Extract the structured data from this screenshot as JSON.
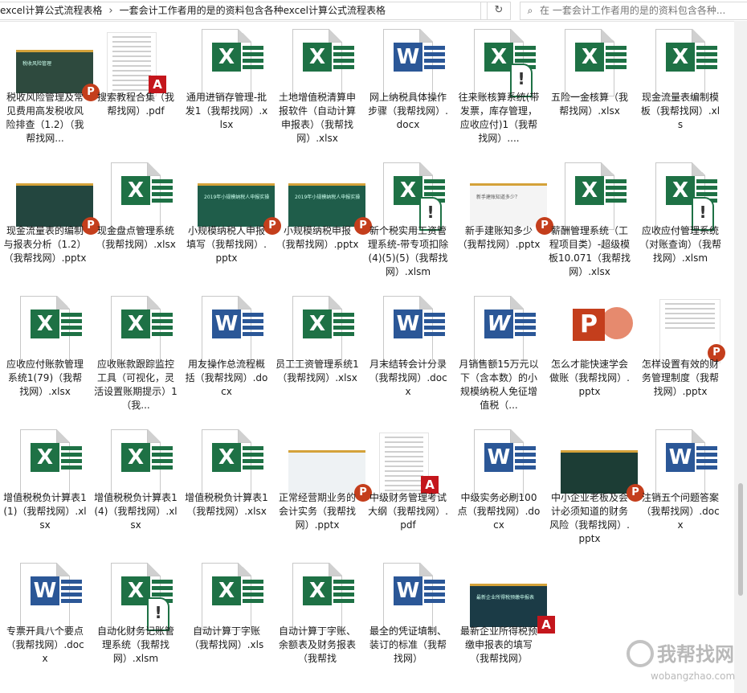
{
  "address_bar": {
    "crumbs": [
      "excel计算公式流程表格",
      "一套会计工作者用的是的资料包含各种excel计算公式流程表格"
    ],
    "chevron": "chevron-down-icon",
    "refresh": "refresh-icon"
  },
  "search": {
    "placeholder": "在 一套会计工作者用的是的资料包含各种..."
  },
  "files": [
    {
      "label": "税收风险管理及常见费用高发税收风险排查（1.2）（我帮找网...",
      "kind": "slide",
      "slide_bg": "#2e4a3e",
      "slide_text": "税收风险管理"
    },
    {
      "label": "搜索教程合集（我帮找网）.pdf",
      "kind": "pdf"
    },
    {
      "label": "通用进销存管理-批发1（我帮找网）.xlsx",
      "kind": "xlsx"
    },
    {
      "label": "土地增值税清算申报软件（自动计算申报表）（我帮找网）.xlsx",
      "kind": "xlsx"
    },
    {
      "label": "网上纳税具体操作步骤（我帮找网）.docx",
      "kind": "docx"
    },
    {
      "label": "往来账核算系统(带发票，库存管理，应收应付)1（我帮找网）....",
      "kind": "xlsm"
    },
    {
      "label": "五险一金核算（我帮找网）.xlsx",
      "kind": "xlsx"
    },
    {
      "label": "现金流量表编制模板（我帮找网）.xls",
      "kind": "xls"
    },
    {
      "label": "现金流量表的编制与报表分析（1.2）（我帮找网）.pptx",
      "kind": "slide",
      "slide_bg": "#23463f",
      "slide_text": ""
    },
    {
      "label": "现金盘点管理系统（我帮找网）.xlsx",
      "kind": "xlsx"
    },
    {
      "label": "小规模纳税人申报填写（我帮找网）.pptx",
      "kind": "slide",
      "slide_bg": "#1f5d4a",
      "slide_text": "2019年小规模纳税人申报实操"
    },
    {
      "label": "小规模纳税申报（我帮找网）.pptx",
      "kind": "slide",
      "slide_bg": "#1f5d4a",
      "slide_text": "2019年小规模纳税人申报实操"
    },
    {
      "label": "新个税实用工资管理系统-带专项扣除(4)(5)(5)（我帮找网）.xlsm",
      "kind": "xlsm"
    },
    {
      "label": "新手建账知多少（我帮找网）.pptx",
      "kind": "slide",
      "slide_bg": "#f4f4f4",
      "slide_text": "新手建账知道多少？"
    },
    {
      "label": "薪酬管理系统（工程项目类）-超级模板10.071（我帮找网）.xlsx",
      "kind": "xlsx"
    },
    {
      "label": "应收应付管理系统（对账查询）（我帮找网）.xlsm",
      "kind": "xlsm"
    },
    {
      "label": "应收应付账款管理系统1(79)（我帮找网）.xlsx",
      "kind": "xlsx"
    },
    {
      "label": "应收账款跟踪监控工具（可视化，灵活设置账期提示）1（我...",
      "kind": "xlsx"
    },
    {
      "label": "用友操作总流程概括（我帮找网）.docx",
      "kind": "docx"
    },
    {
      "label": "员工工资管理系统1（我帮找网）.xlsx",
      "kind": "xlsx"
    },
    {
      "label": "月末结转会计分录（我帮找网）.docx",
      "kind": "docx"
    },
    {
      "label": "月销售额15万元以下（含本数）的小规模纳税人免征增值税（...",
      "kind": "doc"
    },
    {
      "label": "怎么才能快速学会做账（我帮找网）.pptx",
      "kind": "pptbig"
    },
    {
      "label": "怎样设置有效的财务管理制度（我帮找网）.pptx",
      "kind": "paperppt"
    },
    {
      "label": "增值税税负计算表1(1)（我帮找网）.xlsx",
      "kind": "xlsx"
    },
    {
      "label": "增值税税负计算表1(4)（我帮找网）.xlsx",
      "kind": "xlsx"
    },
    {
      "label": "增值税税负计算表1（我帮找网）.xlsx",
      "kind": "xlsx"
    },
    {
      "label": "正常经营期业务的会计实务（我帮找网）.pptx",
      "kind": "slide",
      "slide_bg": "#eef2f4",
      "slide_text": ""
    },
    {
      "label": "中级财务管理考试大纲（我帮找网）.pdf",
      "kind": "pdfpaper"
    },
    {
      "label": "中级实务必刷100点（我帮找网）.docx",
      "kind": "docx"
    },
    {
      "label": "中小企业老板及会计必须知道的财务风险（我帮找网）.pptx",
      "kind": "slide",
      "slide_bg": "#1c3d35",
      "slide_text": ""
    },
    {
      "label": "注销五个问题答案（我帮找网）.docx",
      "kind": "docx"
    },
    {
      "label": "专票开具八个要点（我帮找网）.docx",
      "kind": "docx"
    },
    {
      "label": "自动化财务记账管理系统（我帮找网）.xlsm",
      "kind": "xlsm"
    },
    {
      "label": "自动计算丁字账（我帮找网）.xls",
      "kind": "xls"
    },
    {
      "label": "自动计算丁字账、余额表及财务报表（我帮找",
      "kind": "xls"
    },
    {
      "label": "最全的凭证填制、装订的标准（我帮找网）",
      "kind": "docx"
    },
    {
      "label": "最新企业所得税预缴申报表的填写（我帮找网）",
      "kind": "slidepdf",
      "slide_bg": "#1b3b46",
      "slide_text": "最新企业所得税预缴申报表"
    }
  ],
  "colors": {
    "excel": "#1e7145",
    "word": "#2b5797",
    "ppt": "#c43e1c",
    "pdf": "#c4161c"
  },
  "watermark": {
    "main": "我帮找网",
    "sub": "wobangzhao.com"
  }
}
